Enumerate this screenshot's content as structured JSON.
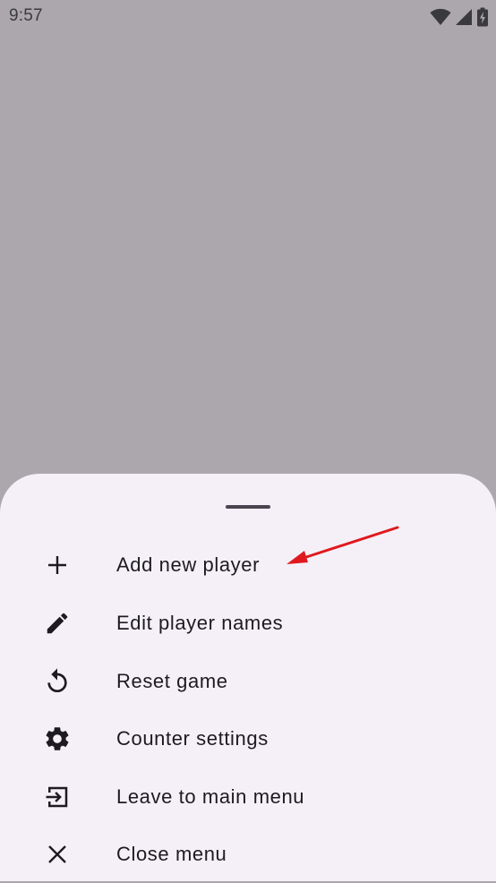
{
  "status_bar": {
    "time": "9:57",
    "icons": [
      "wifi-icon",
      "signal-icon",
      "battery-icon"
    ]
  },
  "menu": {
    "items": [
      {
        "icon": "plus-icon",
        "label": "Add new player"
      },
      {
        "icon": "pencil-icon",
        "label": "Edit player names"
      },
      {
        "icon": "reset-icon",
        "label": "Reset game"
      },
      {
        "icon": "gear-icon",
        "label": "Counter settings"
      },
      {
        "icon": "exit-icon",
        "label": "Leave to main menu"
      },
      {
        "icon": "close-icon",
        "label": "Close menu"
      }
    ]
  },
  "colors": {
    "scrim": "#aba7ac",
    "sheet_background": "#f5f0f8",
    "text": "#1d1b20",
    "annotation_arrow": "#e0191e"
  }
}
